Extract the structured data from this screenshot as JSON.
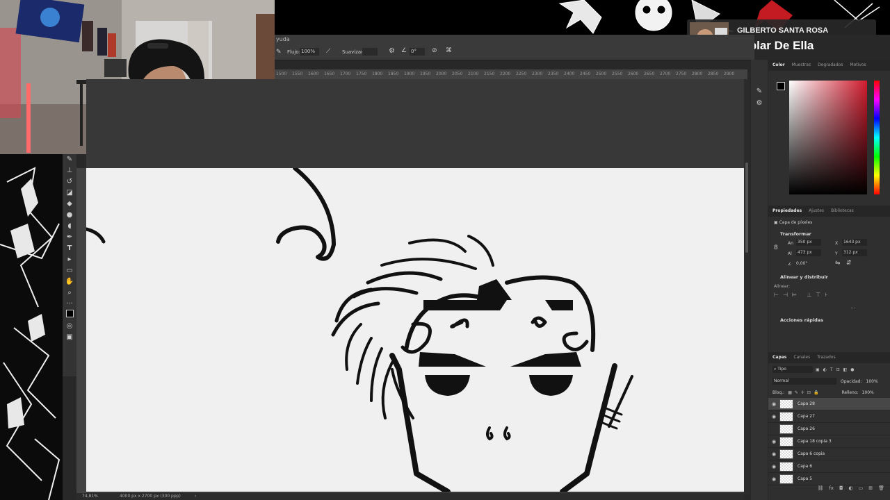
{
  "music": {
    "artist": "GILBERTO SANTA ROSA",
    "song": "Hablar De Ella"
  },
  "menu": {
    "help": "yuda"
  },
  "options": {
    "flujo_label": "Flujo:",
    "flujo_value": "100%",
    "suavizar_label": "Suavizar:",
    "angle_value": "0°"
  },
  "ruler": {
    "ticks": [
      "1500",
      "1550",
      "1600",
      "1650",
      "1700",
      "1750",
      "1800",
      "1850",
      "1900",
      "1950",
      "2000",
      "2050",
      "2100",
      "2150",
      "2200",
      "2250",
      "2300",
      "2350",
      "2400",
      "2450",
      "2500",
      "2550",
      "2600",
      "2650",
      "2700",
      "2750",
      "2800",
      "2850",
      "2900"
    ]
  },
  "status": {
    "zoom": "74,81%",
    "doc_size": "4000 px x 2700 px (300 ppp)"
  },
  "color_panel": {
    "tabs": [
      "Color",
      "Muestras",
      "Degradados",
      "Motivos"
    ],
    "active_tab": "Color",
    "hue_color": "#d01c2e"
  },
  "properties": {
    "tabs": [
      "Propiedades",
      "Ajustes",
      "Bibliotecas"
    ],
    "layer_type": "Capa de píxeles",
    "transform_title": "Transformar",
    "width_label": "An",
    "width_value": "350 px",
    "x_label": "X",
    "x_value": "1643 px",
    "height_label": "Al",
    "height_value": "473 px",
    "y_label": "Y",
    "y_value": "312 px",
    "angle_value": "0,00°",
    "align_title": "Alinear y distribuir",
    "align_label": "Alinear:",
    "quick_actions": "Acciones rápidas"
  },
  "layers_panel": {
    "tabs": [
      "Capas",
      "Canales",
      "Trazados"
    ],
    "filter_value": "Tipo",
    "blend_mode": "Normal",
    "opacity_label": "Opacidad:",
    "opacity_value": "100%",
    "lock_label": "Bloq.:",
    "fill_label": "Relleno:",
    "fill_value": "100%",
    "layers": [
      {
        "name": "Capa 28",
        "visible": true,
        "selected": true
      },
      {
        "name": "Capa 27",
        "visible": true,
        "selected": false
      },
      {
        "name": "Capa 26",
        "visible": false,
        "selected": false
      },
      {
        "name": "Capa 18 copia 3",
        "visible": true,
        "selected": false
      },
      {
        "name": "Capa 6 copia",
        "visible": true,
        "selected": false
      },
      {
        "name": "Capa 6",
        "visible": true,
        "selected": false
      },
      {
        "name": "Capa 5",
        "visible": true,
        "selected": false
      }
    ]
  }
}
